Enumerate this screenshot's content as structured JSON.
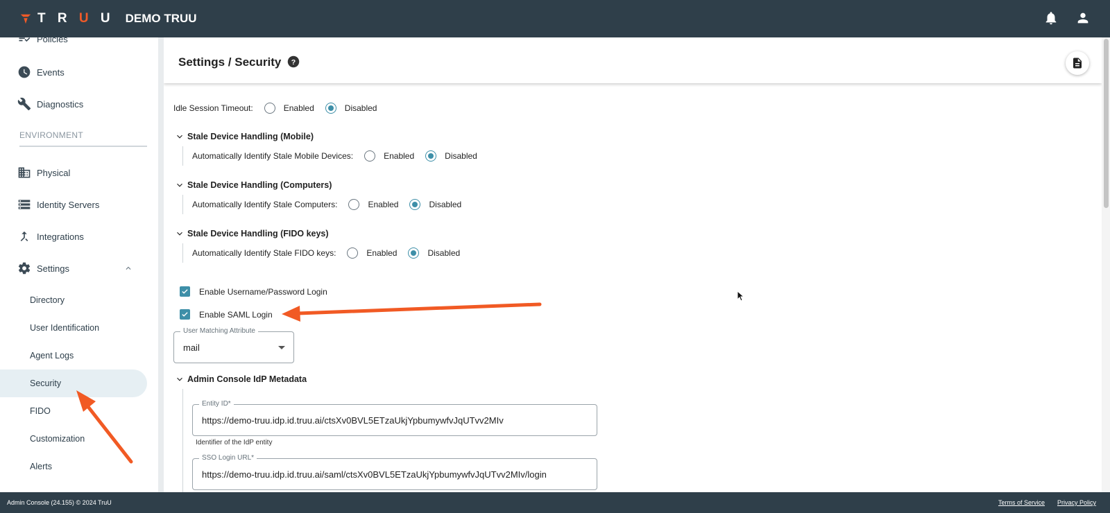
{
  "header": {
    "logo_text": "TRUU",
    "org_name": "DEMO TRUU"
  },
  "sidebar": {
    "items": [
      {
        "label": "Policies",
        "icon": "policies-icon"
      },
      {
        "label": "Events",
        "icon": "clock-icon"
      },
      {
        "label": "Diagnostics",
        "icon": "wrench-icon"
      },
      {
        "label": "Physical",
        "icon": "building-icon"
      },
      {
        "label": "Identity Servers",
        "icon": "servers-icon"
      },
      {
        "label": "Integrations",
        "icon": "merge-icon"
      },
      {
        "label": "Settings",
        "icon": "gear-icon"
      }
    ],
    "section_label": "ENVIRONMENT",
    "settings_sub": [
      "Directory",
      "User Identification",
      "Agent Logs",
      "Security",
      "FIDO",
      "Customization",
      "Alerts"
    ],
    "active_sub": "Security"
  },
  "page": {
    "title": "Settings / Security"
  },
  "settings": {
    "idle_label": "Idle Session Timeout:",
    "enabled": "Enabled",
    "disabled": "Disabled",
    "idle_value": "Disabled",
    "mobile": {
      "title": "Stale Device Handling (Mobile)",
      "label": "Automatically Identify Stale Mobile Devices:",
      "value": "Disabled"
    },
    "computers": {
      "title": "Stale Device Handling (Computers)",
      "label": "Automatically Identify Stale Computers:",
      "value": "Disabled"
    },
    "fido": {
      "title": "Stale Device Handling (FIDO keys)",
      "label": "Automatically Identify Stale FIDO keys:",
      "value": "Disabled"
    },
    "username_login": {
      "label": "Enable Username/Password Login",
      "checked": true
    },
    "saml_login": {
      "label": "Enable SAML Login",
      "checked": true
    },
    "user_matching": {
      "label": "User Matching Attribute",
      "value": "mail"
    },
    "idp_metadata": {
      "title": "Admin Console IdP Metadata",
      "entity_id_label": "Entity ID*",
      "entity_id_value": "https://demo-truu.idp.id.truu.ai/ctsXv0BVL5ETzaUkjYpbumywfvJqUTvv2MIv",
      "entity_id_helper": "Identifier of the IdP entity",
      "sso_label": "SSO Login URL*",
      "sso_value": "https://demo-truu.idp.id.truu.ai/saml/ctsXv0BVL5ETzaUkjYpbumywfvJqUTvv2MIv/login"
    }
  },
  "footer": {
    "copyright": "Admin Console (24.155) © 2024 TruU",
    "terms": "Terms of Service",
    "privacy": "Privacy Policy"
  },
  "colors": {
    "topbar": "#2f3f4a",
    "accent": "#3e8fa8",
    "brand_orange": "#f05a28",
    "annotation_arrow": "#f15a24"
  }
}
